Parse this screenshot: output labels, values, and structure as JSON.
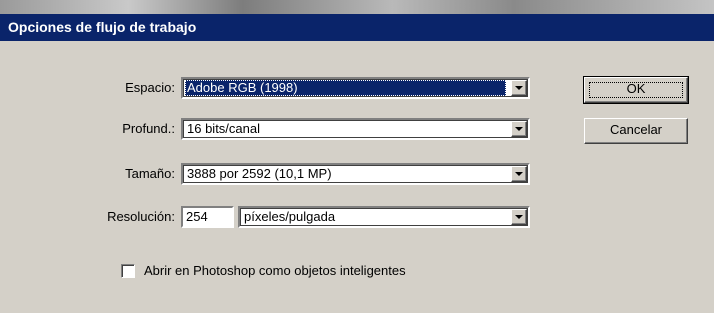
{
  "window": {
    "title": "Opciones de flujo de trabajo"
  },
  "fields": {
    "espacio": {
      "label": "Espacio:",
      "value": "Adobe RGB (1998)"
    },
    "profund": {
      "label": "Profund.:",
      "value": "16 bits/canal"
    },
    "tamano": {
      "label": "Tamaño:",
      "value": "3888 por 2592  (10,1 MP)"
    },
    "resolucion": {
      "label": "Resolución:",
      "value": "254",
      "unit": "píxeles/pulgada"
    }
  },
  "checkbox": {
    "label": "Abrir en Photoshop como objetos inteligentes",
    "checked": false
  },
  "buttons": {
    "ok": "OK",
    "cancel": "Cancelar"
  },
  "colors": {
    "titlebar": "#0a246a",
    "dialog_bg": "#d4d0c8",
    "selection": "#0a246a"
  }
}
